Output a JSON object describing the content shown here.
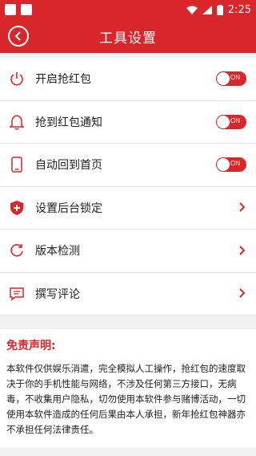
{
  "status_bar": {
    "time": "2:25"
  },
  "header": {
    "title": "工具设置"
  },
  "settings": [
    {
      "label": "开启抢红包",
      "icon": "power-icon",
      "control": "toggle",
      "toggle_text": "ON",
      "state": "on"
    },
    {
      "label": "抢到红包通知",
      "icon": "bell-icon",
      "control": "toggle",
      "toggle_text": "ON",
      "state": "on"
    },
    {
      "label": "自动回到首页",
      "icon": "phone-icon",
      "control": "toggle",
      "toggle_text": "ON",
      "state": "on"
    },
    {
      "label": "设置后台锁定",
      "icon": "shield-icon",
      "control": "chevron"
    },
    {
      "label": "版本检测",
      "icon": "refresh-icon",
      "control": "chevron"
    },
    {
      "label": "撰写评论",
      "icon": "comment-icon",
      "control": "chevron"
    }
  ],
  "disclaimer": {
    "title": "免责声明:",
    "text": "本软件仅供娱乐消遣，完全模拟人工操作，抢红包的速度取决于你的手机性能与网络，不涉及任何第三方接口，无病毒，不收集用户隐私，切勿使用本软件参与赌博活动，一切使用本软件造成的任何后果由本人承担，新年抢红包神器亦不承担任何法律责任。"
  },
  "colors": {
    "accent": "#d9262a"
  }
}
